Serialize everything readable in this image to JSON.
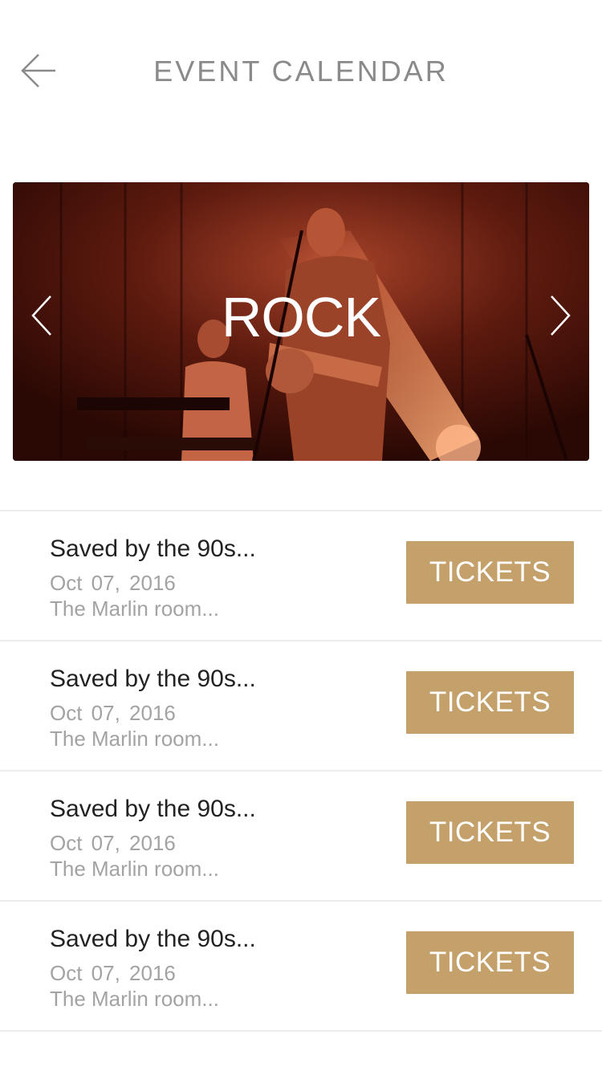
{
  "header": {
    "title": "EVENT CALENDAR",
    "back_icon": "arrow-left-icon"
  },
  "banner": {
    "genre": "ROCK",
    "prev_icon": "chevron-left-icon",
    "next_icon": "chevron-right-icon",
    "tint_color": "#c1502e"
  },
  "events": [
    {
      "name": "Saved by the 90s...",
      "date": "Oct 07, 2016",
      "venue": "The Marlin room...",
      "button": "TICKETS"
    },
    {
      "name": "Saved by the 90s...",
      "date": "Oct 07, 2016",
      "venue": "The Marlin room...",
      "button": "TICKETS"
    },
    {
      "name": "Saved by the 90s...",
      "date": "Oct 07, 2016",
      "venue": "The Marlin room...",
      "button": "TICKETS"
    },
    {
      "name": "Saved by the 90s...",
      "date": "Oct 07, 2016",
      "venue": "The Marlin room...",
      "button": "TICKETS"
    }
  ],
  "colors": {
    "accent": "#c4a06b",
    "title_gray": "#8a8a8a",
    "sub_gray": "#a3a3a3"
  }
}
